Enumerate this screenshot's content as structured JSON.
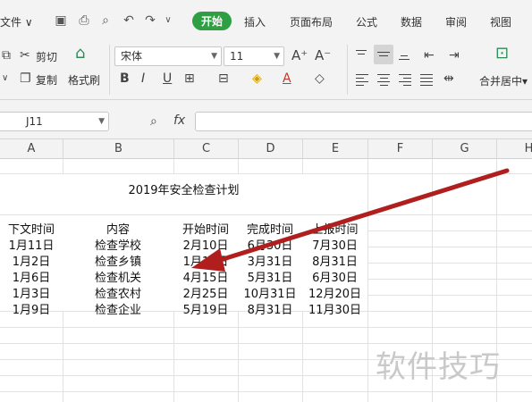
{
  "menubar": {
    "file_label": "文件",
    "tabs": [
      {
        "label": "开始",
        "active": true
      },
      {
        "label": "插入"
      },
      {
        "label": "页面布局"
      },
      {
        "label": "公式"
      },
      {
        "label": "数据"
      },
      {
        "label": "审阅"
      },
      {
        "label": "视图"
      }
    ]
  },
  "ribbon": {
    "cut_label": "剪切",
    "copy_label": "复制",
    "format_painter_label": "格式刷",
    "font_name": "宋体",
    "font_size": "11",
    "merge_center_label": "合并居中"
  },
  "formula_bar": {
    "cell_ref": "J11",
    "fx_label": "fx",
    "content": ""
  },
  "columns": [
    "A",
    "B",
    "C",
    "D",
    "E",
    "F",
    "G",
    "H"
  ],
  "sheet": {
    "title": "2019年安全检查计划",
    "headers": [
      "下文时间",
      "内容",
      "开始时间",
      "完成时间",
      "上报时间"
    ],
    "rows": [
      [
        "1月11日",
        "检查学校",
        "2月10日",
        "6月30日",
        "7月30日"
      ],
      [
        "1月2日",
        "检查乡镇",
        "1月10日",
        "3月31日",
        "8月31日"
      ],
      [
        "1月6日",
        "检查机关",
        "4月15日",
        "5月31日",
        "6月30日"
      ],
      [
        "1月3日",
        "检查农村",
        "2月25日",
        "10月31日",
        "12月20日"
      ],
      [
        "1月9日",
        "检查企业",
        "5月19日",
        "8月31日",
        "11月30日"
      ]
    ]
  },
  "watermark": "软件技巧",
  "colors": {
    "active_tab": "#2ea043",
    "arrow": "#b01e1e",
    "grid_line": "#e2e2e2"
  }
}
